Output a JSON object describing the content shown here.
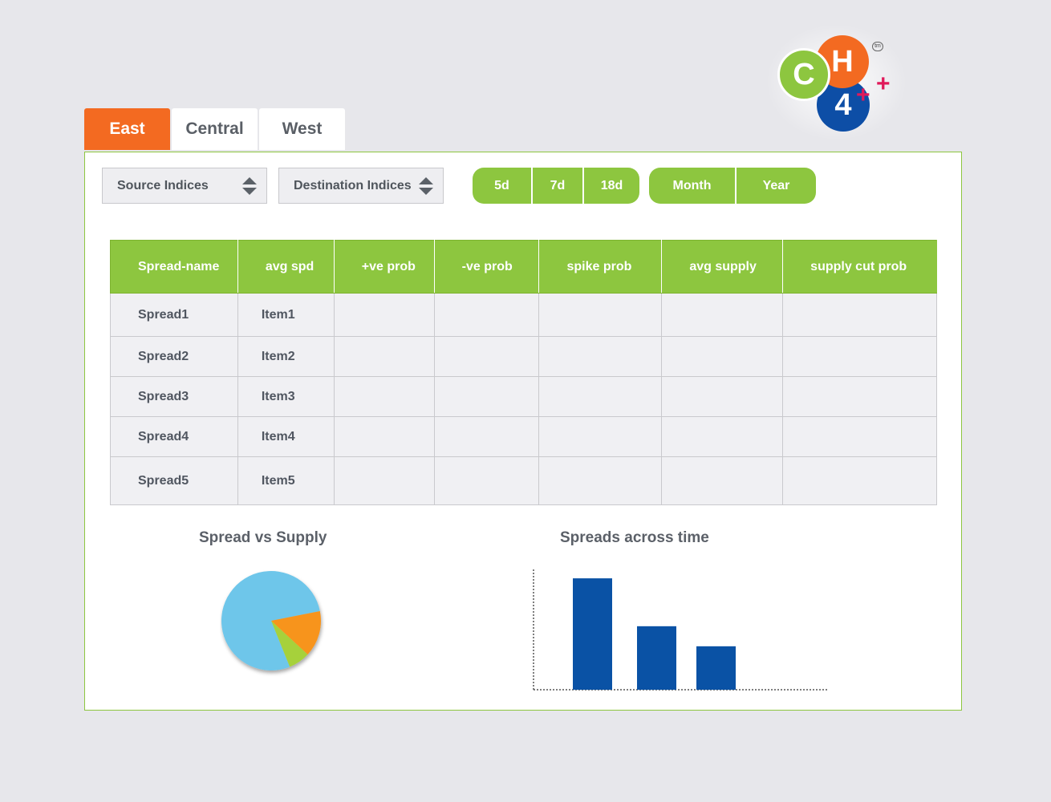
{
  "logo": {
    "c": "C",
    "h": "H",
    "four": "4",
    "plus": "+",
    "tm": "tm"
  },
  "tabs": [
    {
      "label": "East",
      "active": true
    },
    {
      "label": "Central",
      "active": false
    },
    {
      "label": "West",
      "active": false
    }
  ],
  "filters": {
    "source": "Source Indices",
    "destination": "Destination Indices"
  },
  "ranges": {
    "days": [
      "5d",
      "7d",
      "18d"
    ],
    "periods": [
      "Month",
      "Year"
    ]
  },
  "table": {
    "headers": [
      "Spread-name",
      "avg spd",
      "+ve prob",
      "-ve prob",
      "spike prob",
      "avg supply",
      "supply cut prob"
    ],
    "rows": [
      [
        "Spread1",
        "Item1",
        "",
        "",
        "",
        "",
        ""
      ],
      [
        "Spread2",
        "Item2",
        "",
        "",
        "",
        "",
        ""
      ],
      [
        "Spread3",
        "Item3",
        "",
        "",
        "",
        "",
        ""
      ],
      [
        "Spread4",
        "Item4",
        "",
        "",
        "",
        "",
        ""
      ],
      [
        "Spread5",
        "Item5",
        "",
        "",
        "",
        "",
        ""
      ]
    ]
  },
  "colors": {
    "accent_green": "#8dc63f",
    "accent_orange": "#f36a21",
    "bar_blue": "#0a52a5"
  },
  "chart_data": [
    {
      "type": "pie",
      "title": "Spread vs Supply",
      "values": [
        78,
        15,
        7
      ],
      "colors": [
        "#6ec6ea",
        "#f7941d",
        "#a6d13b"
      ]
    },
    {
      "type": "bar",
      "title": "Spreads across time",
      "categories": [
        "",
        "",
        ""
      ],
      "values": [
        100,
        57,
        39
      ],
      "ylim": [
        0,
        108
      ],
      "xlabel": "",
      "ylabel": ""
    }
  ]
}
